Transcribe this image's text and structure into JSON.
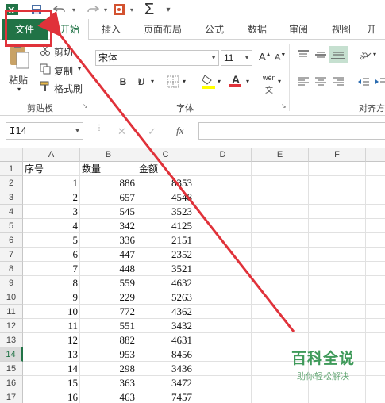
{
  "qat": {
    "excel_icon": "excel-logo-icon",
    "save_icon": "save-icon",
    "undo_icon": "undo-icon",
    "redo_icon": "redo-icon",
    "macro_icon": "presentation-icon",
    "autosum_glyph": "Σ",
    "customize_glyph": "▾"
  },
  "tabs": {
    "file": "文件",
    "home": "开始",
    "insert": "插入",
    "page_layout": "页面布局",
    "formulas": "公式",
    "data": "数据",
    "review": "审阅",
    "view": "视图",
    "developer": "开发"
  },
  "clipboard": {
    "paste": "粘贴",
    "cut": "剪切",
    "copy": "复制",
    "format_painter": "格式刷",
    "group_label": "剪贴板"
  },
  "font": {
    "font_name": "宋体",
    "font_size": "11",
    "bold": "B",
    "italic": "I",
    "underline": "U",
    "font_color_glyph": "A",
    "phonetic": "wén",
    "group_label": "字体"
  },
  "alignment": {
    "group_label": "对齐方"
  },
  "formula_bar": {
    "name_box": "I14",
    "fx": "fx",
    "cancel_glyph": "✕",
    "enter_glyph": "✓",
    "formula": ""
  },
  "grid": {
    "columns": [
      "A",
      "B",
      "C",
      "D",
      "E",
      "F"
    ],
    "header_row": [
      "序号",
      "数量",
      "金额"
    ],
    "active_row": "14",
    "rows": [
      {
        "n": "1",
        "a": "序号",
        "b": "数量",
        "c": "金额"
      },
      {
        "n": "2",
        "a": "1",
        "b": "886",
        "c": "8353"
      },
      {
        "n": "3",
        "a": "2",
        "b": "657",
        "c": "4548"
      },
      {
        "n": "4",
        "a": "3",
        "b": "545",
        "c": "3523"
      },
      {
        "n": "5",
        "a": "4",
        "b": "342",
        "c": "4125"
      },
      {
        "n": "6",
        "a": "5",
        "b": "336",
        "c": "2151"
      },
      {
        "n": "7",
        "a": "6",
        "b": "447",
        "c": "2352"
      },
      {
        "n": "8",
        "a": "7",
        "b": "448",
        "c": "3521"
      },
      {
        "n": "9",
        "a": "8",
        "b": "559",
        "c": "4632"
      },
      {
        "n": "10",
        "a": "9",
        "b": "229",
        "c": "5263"
      },
      {
        "n": "11",
        "a": "10",
        "b": "772",
        "c": "4362"
      },
      {
        "n": "12",
        "a": "11",
        "b": "551",
        "c": "3432"
      },
      {
        "n": "13",
        "a": "12",
        "b": "882",
        "c": "4631"
      },
      {
        "n": "14",
        "a": "13",
        "b": "953",
        "c": "8456"
      },
      {
        "n": "15",
        "a": "14",
        "b": "298",
        "c": "3436"
      },
      {
        "n": "16",
        "a": "15",
        "b": "363",
        "c": "3472"
      },
      {
        "n": "17",
        "a": "16",
        "b": "463",
        "c": "7457"
      }
    ]
  },
  "watermark": {
    "title": "百科全说",
    "subtitle": "助你轻松解决"
  },
  "colors": {
    "excel_green": "#217346",
    "annotation_red": "#e0323a",
    "watermark_green": "#3f9a5a"
  }
}
